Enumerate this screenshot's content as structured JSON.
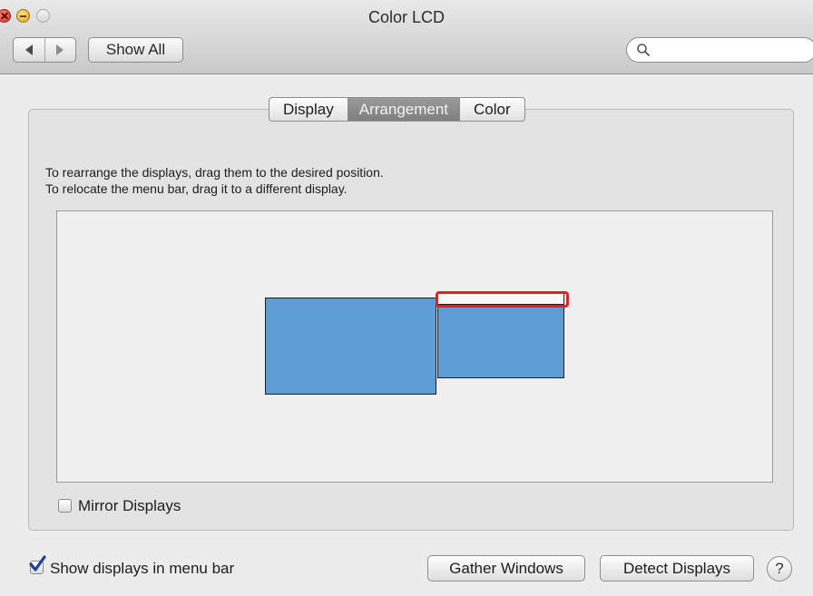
{
  "window": {
    "title": "Color LCD"
  },
  "toolbar": {
    "back_icon": "triangle-left-icon",
    "forward_icon": "triangle-right-icon",
    "show_all_label": "Show All",
    "search_placeholder": "",
    "search_icon": "magnifier-icon"
  },
  "tabs": [
    {
      "label": "Display",
      "selected": false
    },
    {
      "label": "Arrangement",
      "selected": true
    },
    {
      "label": "Color",
      "selected": false
    }
  ],
  "instructions": {
    "line1": "To rearrange the displays, drag them to the desired position.",
    "line2": "To relocate the menu bar, drag it to a different display."
  },
  "arrangement": {
    "display_color": "#5e9cd6",
    "highlight_color": "#d6242b"
  },
  "mirror": {
    "label": "Mirror Displays",
    "checked": false
  },
  "menu_bar_option": {
    "label": "Show displays in menu bar",
    "checked": true
  },
  "buttons": {
    "gather": "Gather Windows",
    "detect": "Detect Displays",
    "help": "?"
  }
}
